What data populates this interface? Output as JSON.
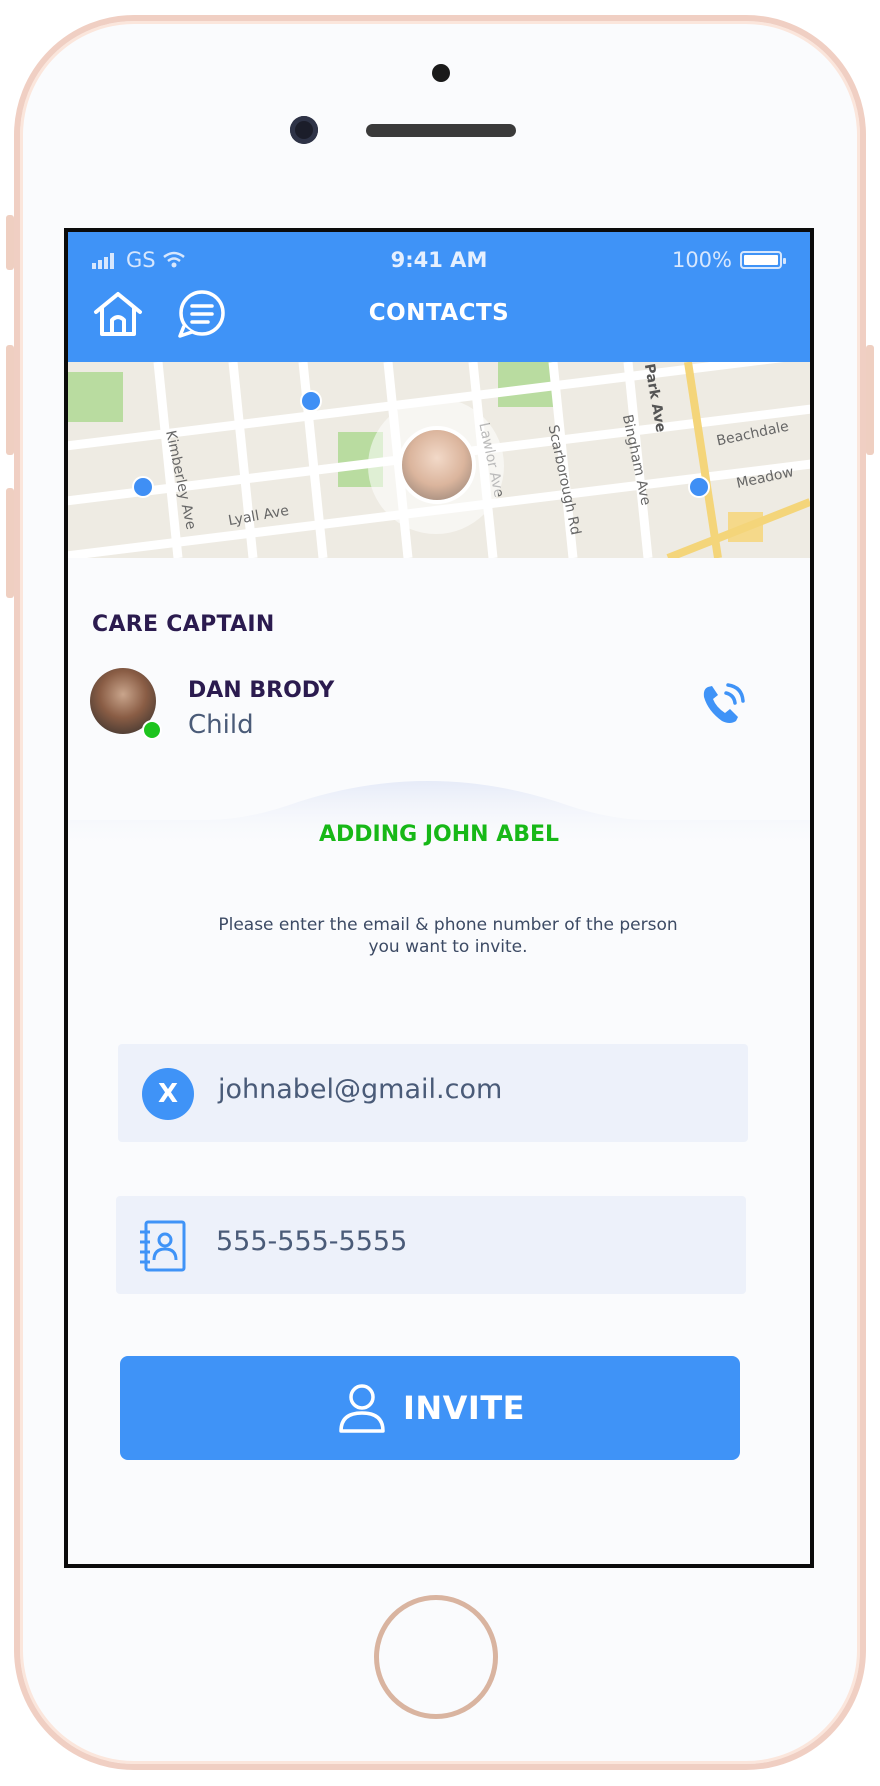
{
  "status_bar": {
    "carrier": "GS",
    "time": "9:41 AM",
    "battery": "100%"
  },
  "header": {
    "title": "CONTACTS"
  },
  "map": {
    "street_labels": [
      "Kimberley Ave",
      "Lyall Ave",
      "Lawlor Ave",
      "Scarborough Rd",
      "Bingham Ave",
      "Park Ave",
      "Beachdale",
      "Meadow"
    ]
  },
  "captain_section": {
    "title": "CARE CAPTAIN",
    "name": "DAN BRODY",
    "role": "Child"
  },
  "adding": {
    "title": "ADDING JOHN ABEL",
    "instruction_line1": "Please enter the email & phone number of the person",
    "instruction_line2": "you want to invite."
  },
  "form": {
    "email_value": "johnabel@gmail.com",
    "clear_label": "X",
    "phone_value": "555-555-5555"
  },
  "invite_button": {
    "label": "INVITE"
  },
  "colors": {
    "primary": "#3f93f7",
    "accent_green": "#17b817",
    "heading": "#2b1b4f"
  },
  "icons": [
    "signal-icon",
    "wifi-icon",
    "battery-icon",
    "home-icon",
    "chat-icon",
    "phone-call-icon",
    "contact-book-icon",
    "user-icon"
  ]
}
